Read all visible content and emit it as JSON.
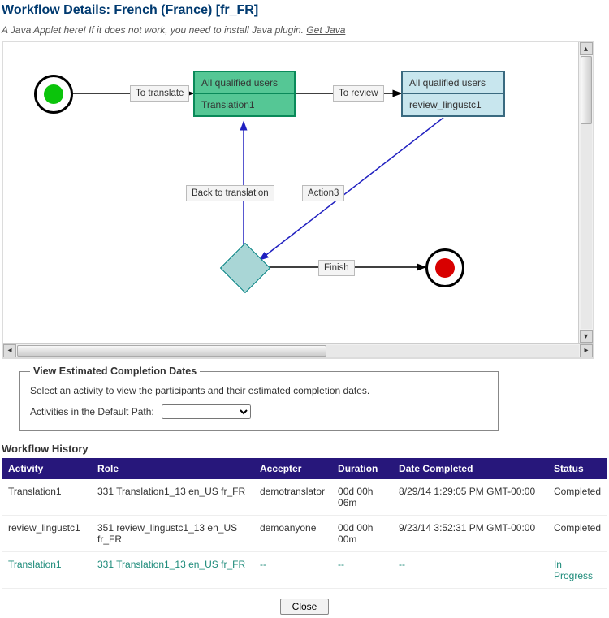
{
  "title": "Workflow Details: French (France) [fr_FR]",
  "applet_note": "A Java Applet here! If it does not work, you need to install Java plugin.",
  "get_java_label": "Get Java",
  "diagram": {
    "node_translate": {
      "line1": "All qualified users",
      "line2": "Translation1"
    },
    "node_review": {
      "line1": "All qualified users",
      "line2": "review_lingustc1"
    },
    "edge_to_translate": "To translate",
    "edge_to_review": "To review",
    "edge_back": "Back to translation",
    "edge_action3": "Action3",
    "edge_finish": "Finish"
  },
  "view_estimated": {
    "legend": "View Estimated Completion Dates",
    "desc": "Select an activity to view the participants and their estimated completion dates.",
    "label": "Activities in the Default Path:"
  },
  "history": {
    "title": "Workflow History",
    "headers": {
      "activity": "Activity",
      "role": "Role",
      "accepter": "Accepter",
      "duration": "Duration",
      "date": "Date Completed",
      "status": "Status"
    },
    "rows": [
      {
        "activity": "Translation1",
        "role": "331 Translation1_13 en_US fr_FR",
        "accepter": "demotranslator",
        "duration": "00d 00h 06m",
        "date": "8/29/14 1:29:05 PM GMT-00:00",
        "status": "Completed"
      },
      {
        "activity": "review_lingustc1",
        "role": "351 review_lingustc1_13 en_US fr_FR",
        "accepter": "demoanyone",
        "duration": "00d 00h 00m",
        "date": "9/23/14 3:52:31 PM GMT-00:00",
        "status": "Completed"
      },
      {
        "activity": "Translation1",
        "role": "331 Translation1_13 en_US fr_FR",
        "accepter": "--",
        "duration": "--",
        "date": "--",
        "status": "In Progress"
      }
    ]
  },
  "close_label": "Close"
}
